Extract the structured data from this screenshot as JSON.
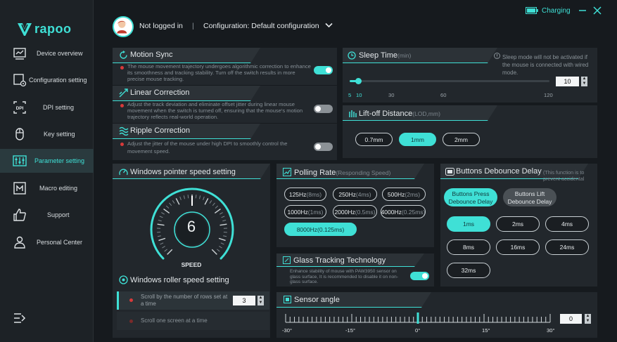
{
  "brand": {
    "name": "rapoo"
  },
  "header": {
    "login_status": "Not logged in",
    "separator": "|",
    "configuration": "Configuration: Default configuration",
    "charging": "Charging"
  },
  "sidebar": {
    "items": [
      {
        "label": "Device overview",
        "icon": "monitor-chart-icon"
      },
      {
        "label": "Configuration setting",
        "icon": "config-gear-icon"
      },
      {
        "label": "DPI setting",
        "icon": "dpi-icon"
      },
      {
        "label": "Key setting",
        "icon": "mouse-icon"
      },
      {
        "label": "Parameter setting",
        "icon": "sliders-icon",
        "active": true
      },
      {
        "label": "Macro editing",
        "icon": "macro-icon"
      },
      {
        "label": "Support",
        "icon": "thumbs-up-icon"
      },
      {
        "label": "Personal Center",
        "icon": "person-icon"
      }
    ],
    "expand_icon": "expand-menu-icon"
  },
  "motion_sync": {
    "title": "Motion Sync",
    "desc": "The mouse movement trajectory undergoes algorithmic correction to enhance its smoothness and tracking stability. Turn off the switch results in more precise mouse tracking.",
    "enabled": true
  },
  "linear_correction": {
    "title": "Linear Correction",
    "desc": "Adjust the track deviation and eliminate offset jitter during linear mouse movement when the switch is turned off, ensuring that the mouse's motion trajectory reflects real-world operation.",
    "enabled": false
  },
  "ripple_correction": {
    "title": "Ripple Correction",
    "desc": "Adjust the jitter of the mouse under high DPI to smoothly control the movement speed.",
    "enabled": false
  },
  "sleep_time": {
    "title": "Sleep Time",
    "unit": "(min)",
    "note": "Sleep mode will not be activated if the mouse is connected with wired mode.",
    "value": "10",
    "min": 5,
    "max": 120,
    "ticks": [
      "5",
      "10",
      "30",
      "60",
      "120"
    ]
  },
  "lift_off": {
    "title": "Lift-off Distance",
    "unit": "(LOD,mm)",
    "options": [
      "0.7mm",
      "1mm",
      "2mm"
    ],
    "selected": "1mm"
  },
  "pointer_speed": {
    "title": "Windows pointer speed setting",
    "value": "6",
    "label": "SPEED",
    "min": 1,
    "max": 11
  },
  "polling_rate": {
    "title": "Polling Rate",
    "sub": "(Responding Speed)",
    "options": [
      {
        "hz": "125Hz",
        "ms": "(8ms)"
      },
      {
        "hz": "250Hz",
        "ms": "(4ms)"
      },
      {
        "hz": "500Hz",
        "ms": "(2ms)"
      },
      {
        "hz": "1000Hz",
        "ms": "(1ms)"
      },
      {
        "hz": "2000Hz",
        "ms": "(0.5ms)"
      },
      {
        "hz": "4000Hz",
        "ms": "(0.25ms)"
      },
      {
        "hz": "8000Hz",
        "ms": "(0.125ms)"
      }
    ],
    "selected": "8000Hz"
  },
  "debounce": {
    "title": "Buttons Debounce Delay",
    "sub": "(This function is to prevent accidental double-clicking of buttons)",
    "tabs": [
      "Buttons Press Debounce Delay",
      "Buttons Lift Debounce Delay"
    ],
    "options": [
      "1ms",
      "2ms",
      "4ms",
      "8ms",
      "16ms",
      "24ms",
      "32ms"
    ],
    "selected": "1ms"
  },
  "glass": {
    "title": "Glass Tracking Technology",
    "desc": "Enhance stability of mouse with PAW3950 sensor on glass surface, It is recommended to disable it on non-glass surface.",
    "enabled": true
  },
  "roller": {
    "title": "Windows roller speed setting",
    "option1": "Scroll by the number of rows set at a time",
    "option1_value": "3",
    "option2": "Scroll one screen at a time"
  },
  "sensor_angle": {
    "title": "Sensor angle",
    "value": "0",
    "min": -30,
    "max": 30,
    "labels": [
      "-30°",
      "-15°",
      "0°",
      "15°",
      "30°"
    ]
  },
  "colors": {
    "accent": "#3fe0d6",
    "panel": "#22272c",
    "background": "#161a1e",
    "danger": "#d83a3a"
  }
}
